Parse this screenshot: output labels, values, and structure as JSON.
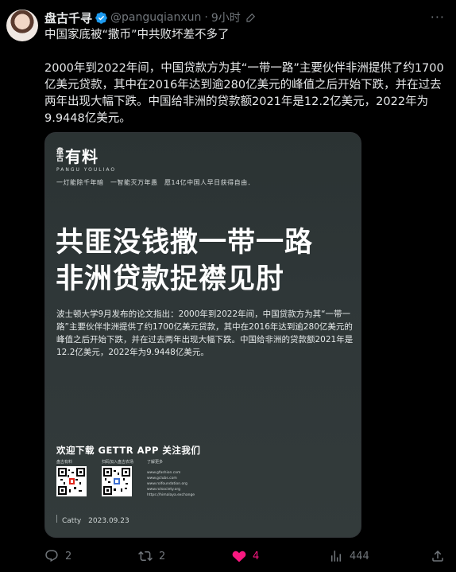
{
  "tweet": {
    "display_name": "盘古千寻",
    "handle": "@panguqianxun",
    "separator": "·",
    "time": "9小时",
    "more_label": "···",
    "paragraph1": "中国家底被“撒币”中共败坏差不多了",
    "paragraph2": "2000年到2022年间，中国贷款方为其“一带一路”主要伙伴非洲提供了约1700亿美元贷款，其中在2016年达到逾280亿美元的峰值之后开始下跌，并在过去两年出现大幅下跌。中国给非洲的贷款额2021年是12.2亿美元，2022年为9.9448亿美元。"
  },
  "card": {
    "logo_small": "盘古",
    "logo_big": "有料",
    "logo_sub": "PANGU YOULIAO",
    "slogan": "一灯能除千年暗　一智能灭万年愚　愿14亿中国人早日获得自由．",
    "headline_line1": "共匪没钱撒一带一路",
    "headline_line2": "非洲贷款捉襟见肘",
    "body": "波士顿大学9月发布的论文指出：2000年到2022年间，中国贷款方为其“一带一路”主要伙伴非洲提供了约1700亿美元贷款，其中在2016年达到逾280亿美元的峰值之后开始下跌，并在过去两年出现大幅下跌。中国给非洲的贷款额2021年是12.2亿美元，2022年为9.9448亿美元。",
    "follow": "欢迎下载 GETTR APP 关注我们",
    "qr1_label": "盘古有料",
    "qr2_label": "扫码加入盘古农场",
    "links_label": "了解更多",
    "links": [
      "www.gfashion.com",
      "www.gclubs.com",
      "www.rolfoundation.org",
      "www.rolsociety.org",
      "https://himalaya.exchange"
    ],
    "footer": "Catty　2023.09.23"
  },
  "actions": {
    "replies": "2",
    "reposts": "2",
    "likes": "4",
    "views": "444"
  },
  "colors": {
    "background": "#000000",
    "text": "#e7e9ea",
    "muted": "#71767b",
    "like": "#f91880",
    "verified": "#1d9bf0"
  }
}
